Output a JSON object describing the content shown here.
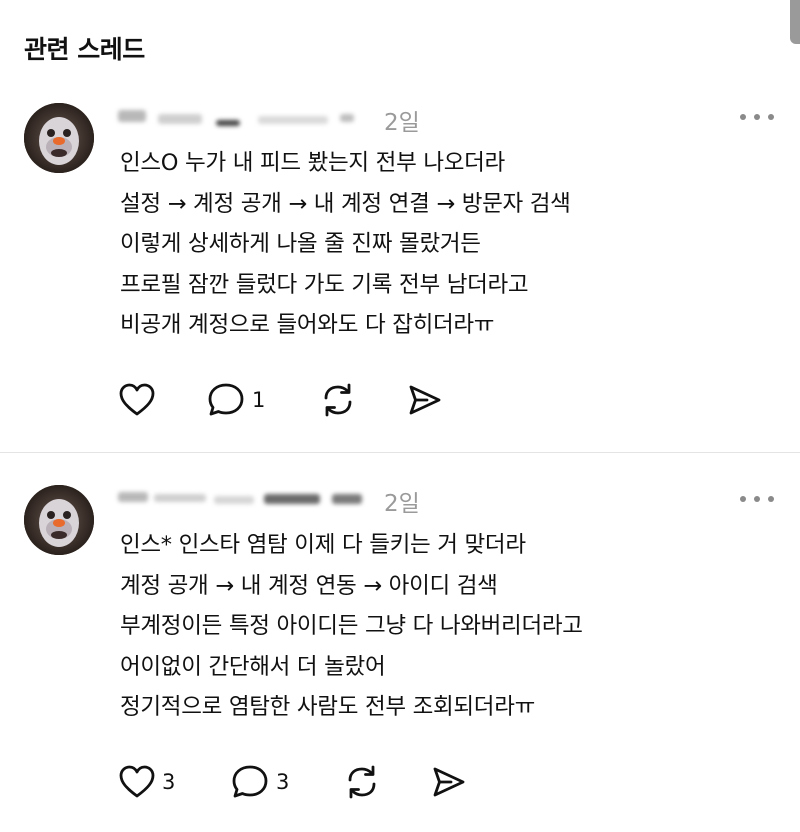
{
  "header": {
    "title": "관련 스레드"
  },
  "posts": [
    {
      "timestamp": "2일",
      "lines": [
        "인스O 누가 내 피드 봤는지 전부 나오더라",
        "설정 → 계정 공개 → 내 계정 연결 → 방문자 검색",
        "이렇게 상세하게 나올 줄 진짜 몰랐거든",
        "프로필 잠깐 들렀다 가도 기록 전부 남더라고",
        "비공개 계정으로 들어와도 다 잡히더라ㅠ"
      ],
      "likes": "",
      "replies": "1"
    },
    {
      "timestamp": "2일",
      "lines": [
        "인스* 인스타 염탐 이제 다 들키는 거 맞더라",
        "계정 공개 → 내 계정 연동 → 아이디 검색",
        "부계정이든 특정 아이디든 그냥 다 나와버리더라고",
        "어이없이 간단해서 더 놀랐어",
        "정기적으로 염탐한 사람도 전부 조회되더라ㅠ"
      ],
      "likes": "3",
      "replies": "3"
    }
  ],
  "icons": {
    "like": "heart-icon",
    "reply": "speech-bubble-icon",
    "repost": "repost-icon",
    "share": "send-icon",
    "more": "more-dots-icon"
  }
}
